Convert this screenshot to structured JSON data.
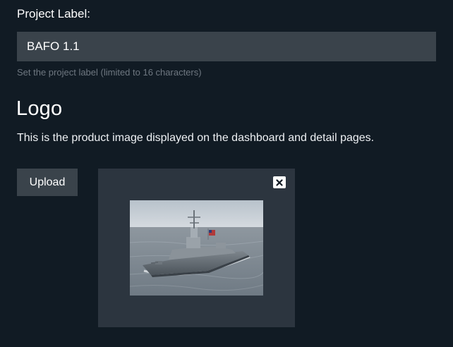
{
  "project_label": {
    "label": "Project Label:",
    "value": "BAFO 1.1",
    "help": "Set the project label (limited to 16 characters)"
  },
  "logo": {
    "title": "Logo",
    "description": "This is the product image displayed on the dashboard and detail pages.",
    "upload_label": "Upload",
    "close_icon": "close-icon",
    "image_subject": "navy-destroyer-ship-photo"
  },
  "colors": {
    "background": "#111b24",
    "input_bg": "#3a434b",
    "panel_bg": "#2c353f",
    "help_text": "#6e7780"
  }
}
